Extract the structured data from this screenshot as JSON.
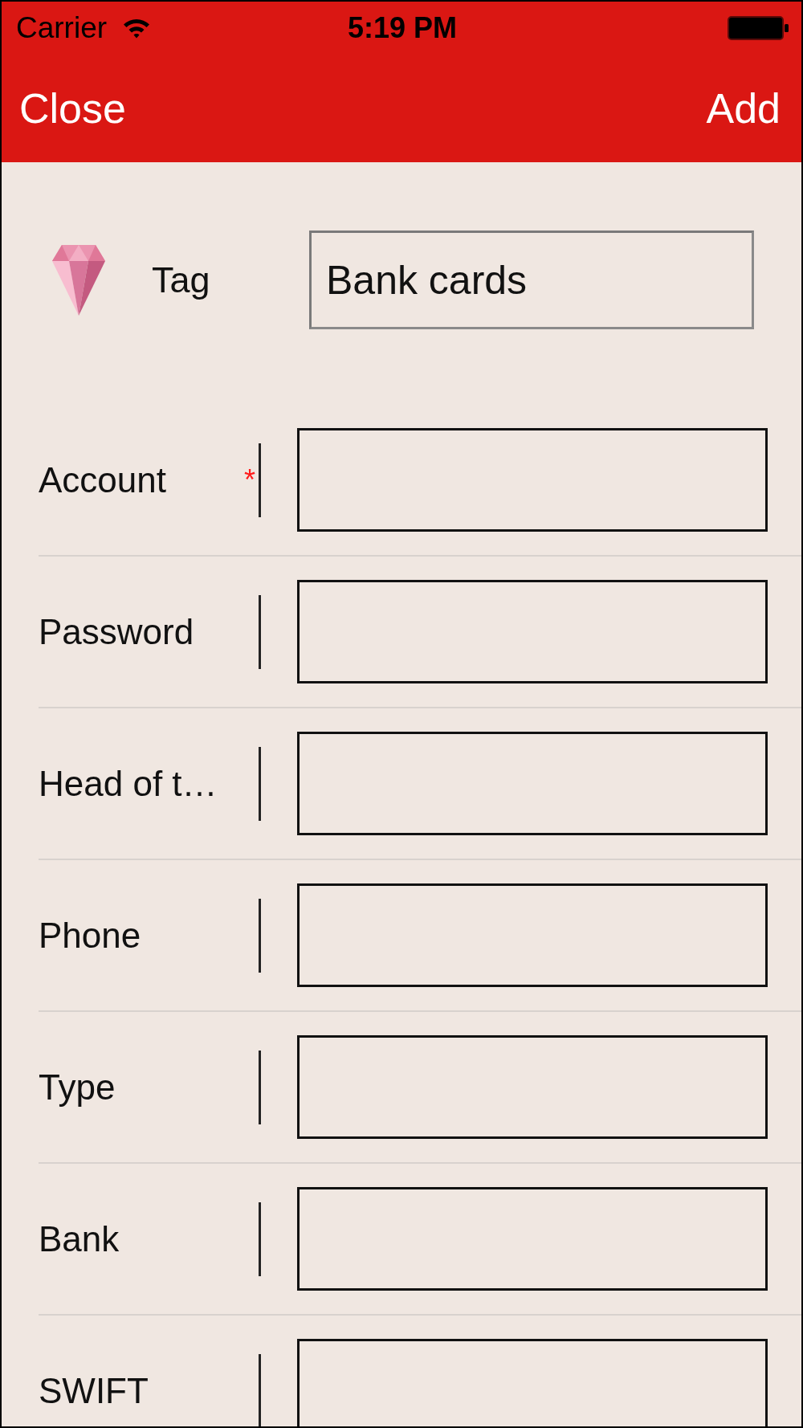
{
  "status_bar": {
    "carrier": "Carrier",
    "time": "5:19 PM"
  },
  "nav_bar": {
    "left_button": "Close",
    "right_button": "Add"
  },
  "tag": {
    "label": "Tag",
    "value": "Bank cards"
  },
  "form": {
    "required_mark": "*",
    "fields": [
      {
        "label": "Account",
        "required": true
      },
      {
        "label": "Password",
        "required": false
      },
      {
        "label": "Head of t…",
        "required": false
      },
      {
        "label": "Phone",
        "required": false
      },
      {
        "label": "Type",
        "required": false
      },
      {
        "label": "Bank",
        "required": false
      },
      {
        "label": "SWIFT",
        "required": false
      }
    ]
  }
}
